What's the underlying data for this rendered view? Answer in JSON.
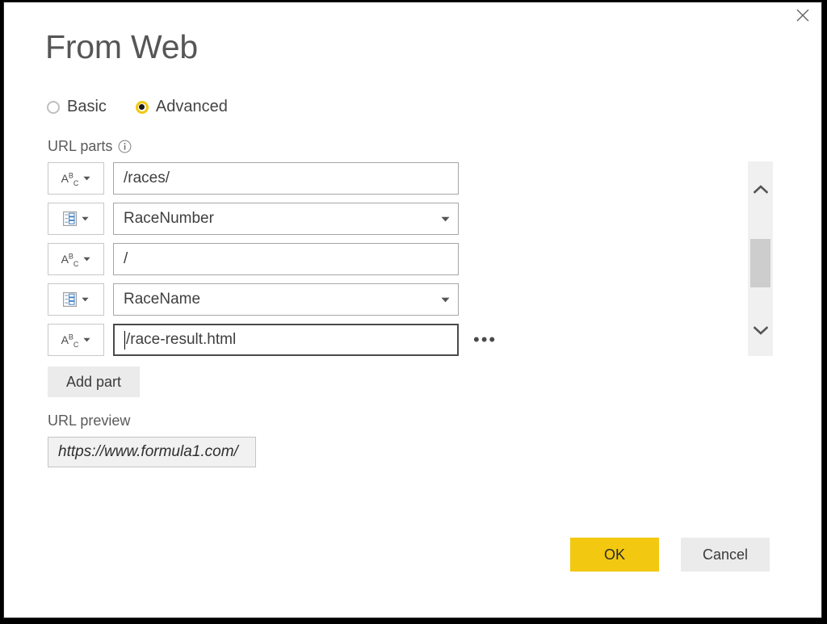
{
  "window": {
    "title": "From Web",
    "close_icon": "close-icon"
  },
  "mode": {
    "basic_label": "Basic",
    "advanced_label": "Advanced",
    "selected": "Advanced"
  },
  "url_parts": {
    "section_label": "URL parts",
    "info_icon": "info-icon",
    "add_part_label": "Add part",
    "ellipsis_label": "•••",
    "rows": [
      {
        "type_icon": "text-type-icon",
        "type": "Text",
        "value": "/races/",
        "kind": "text",
        "focused": false
      },
      {
        "type_icon": "parameter-type-icon",
        "type": "Parameter",
        "value": "RaceNumber",
        "kind": "combo",
        "focused": false
      },
      {
        "type_icon": "text-type-icon",
        "type": "Text",
        "value": "/",
        "kind": "text",
        "focused": false
      },
      {
        "type_icon": "parameter-type-icon",
        "type": "Parameter",
        "value": "RaceName",
        "kind": "combo",
        "focused": false
      },
      {
        "type_icon": "text-type-icon",
        "type": "Text",
        "value": "/race-result.html",
        "kind": "text",
        "focused": true
      }
    ]
  },
  "preview": {
    "label": "URL preview",
    "value": "https://www.formula1.com/"
  },
  "scrollbar": {
    "up_icon": "chevron-up-icon",
    "down_icon": "chevron-down-icon"
  },
  "footer": {
    "ok_label": "OK",
    "cancel_label": "Cancel"
  },
  "colors": {
    "accent": "#f2c811",
    "text": "#444444",
    "border": "#a6a6a6",
    "frame": "#2b2b2b"
  }
}
